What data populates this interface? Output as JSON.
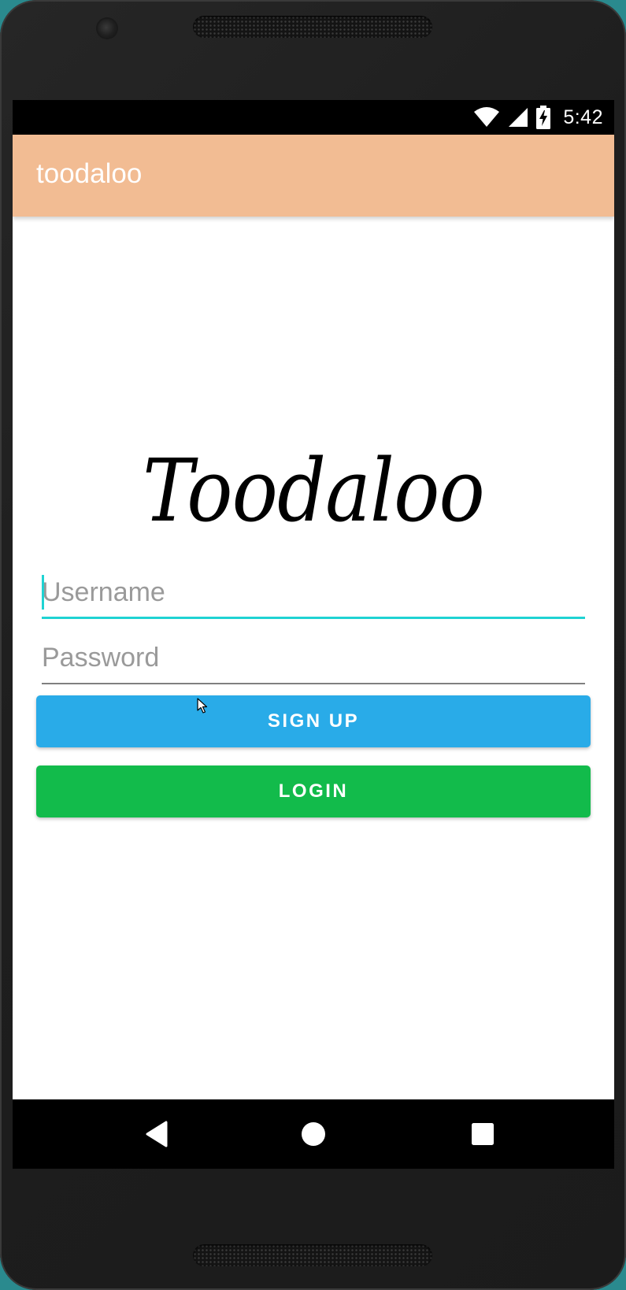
{
  "status_bar": {
    "time": "5:42",
    "icons": [
      "wifi-icon",
      "cell-signal-icon",
      "battery-charging-icon"
    ]
  },
  "app_bar": {
    "title": "toodaloo",
    "color": "#f2bc93"
  },
  "login": {
    "logo_text": "Toodaloo",
    "username": {
      "placeholder": "Username",
      "value": "",
      "focused": true
    },
    "password": {
      "placeholder": "Password",
      "value": ""
    },
    "signup_label": "SIGN UP",
    "login_label": "LOGIN",
    "signup_color": "#29abe8",
    "login_color": "#12bb4b",
    "focus_color": "#1fd3d3"
  },
  "nav_bar": {
    "icons": [
      "back-icon",
      "home-icon",
      "recent-apps-icon"
    ]
  }
}
